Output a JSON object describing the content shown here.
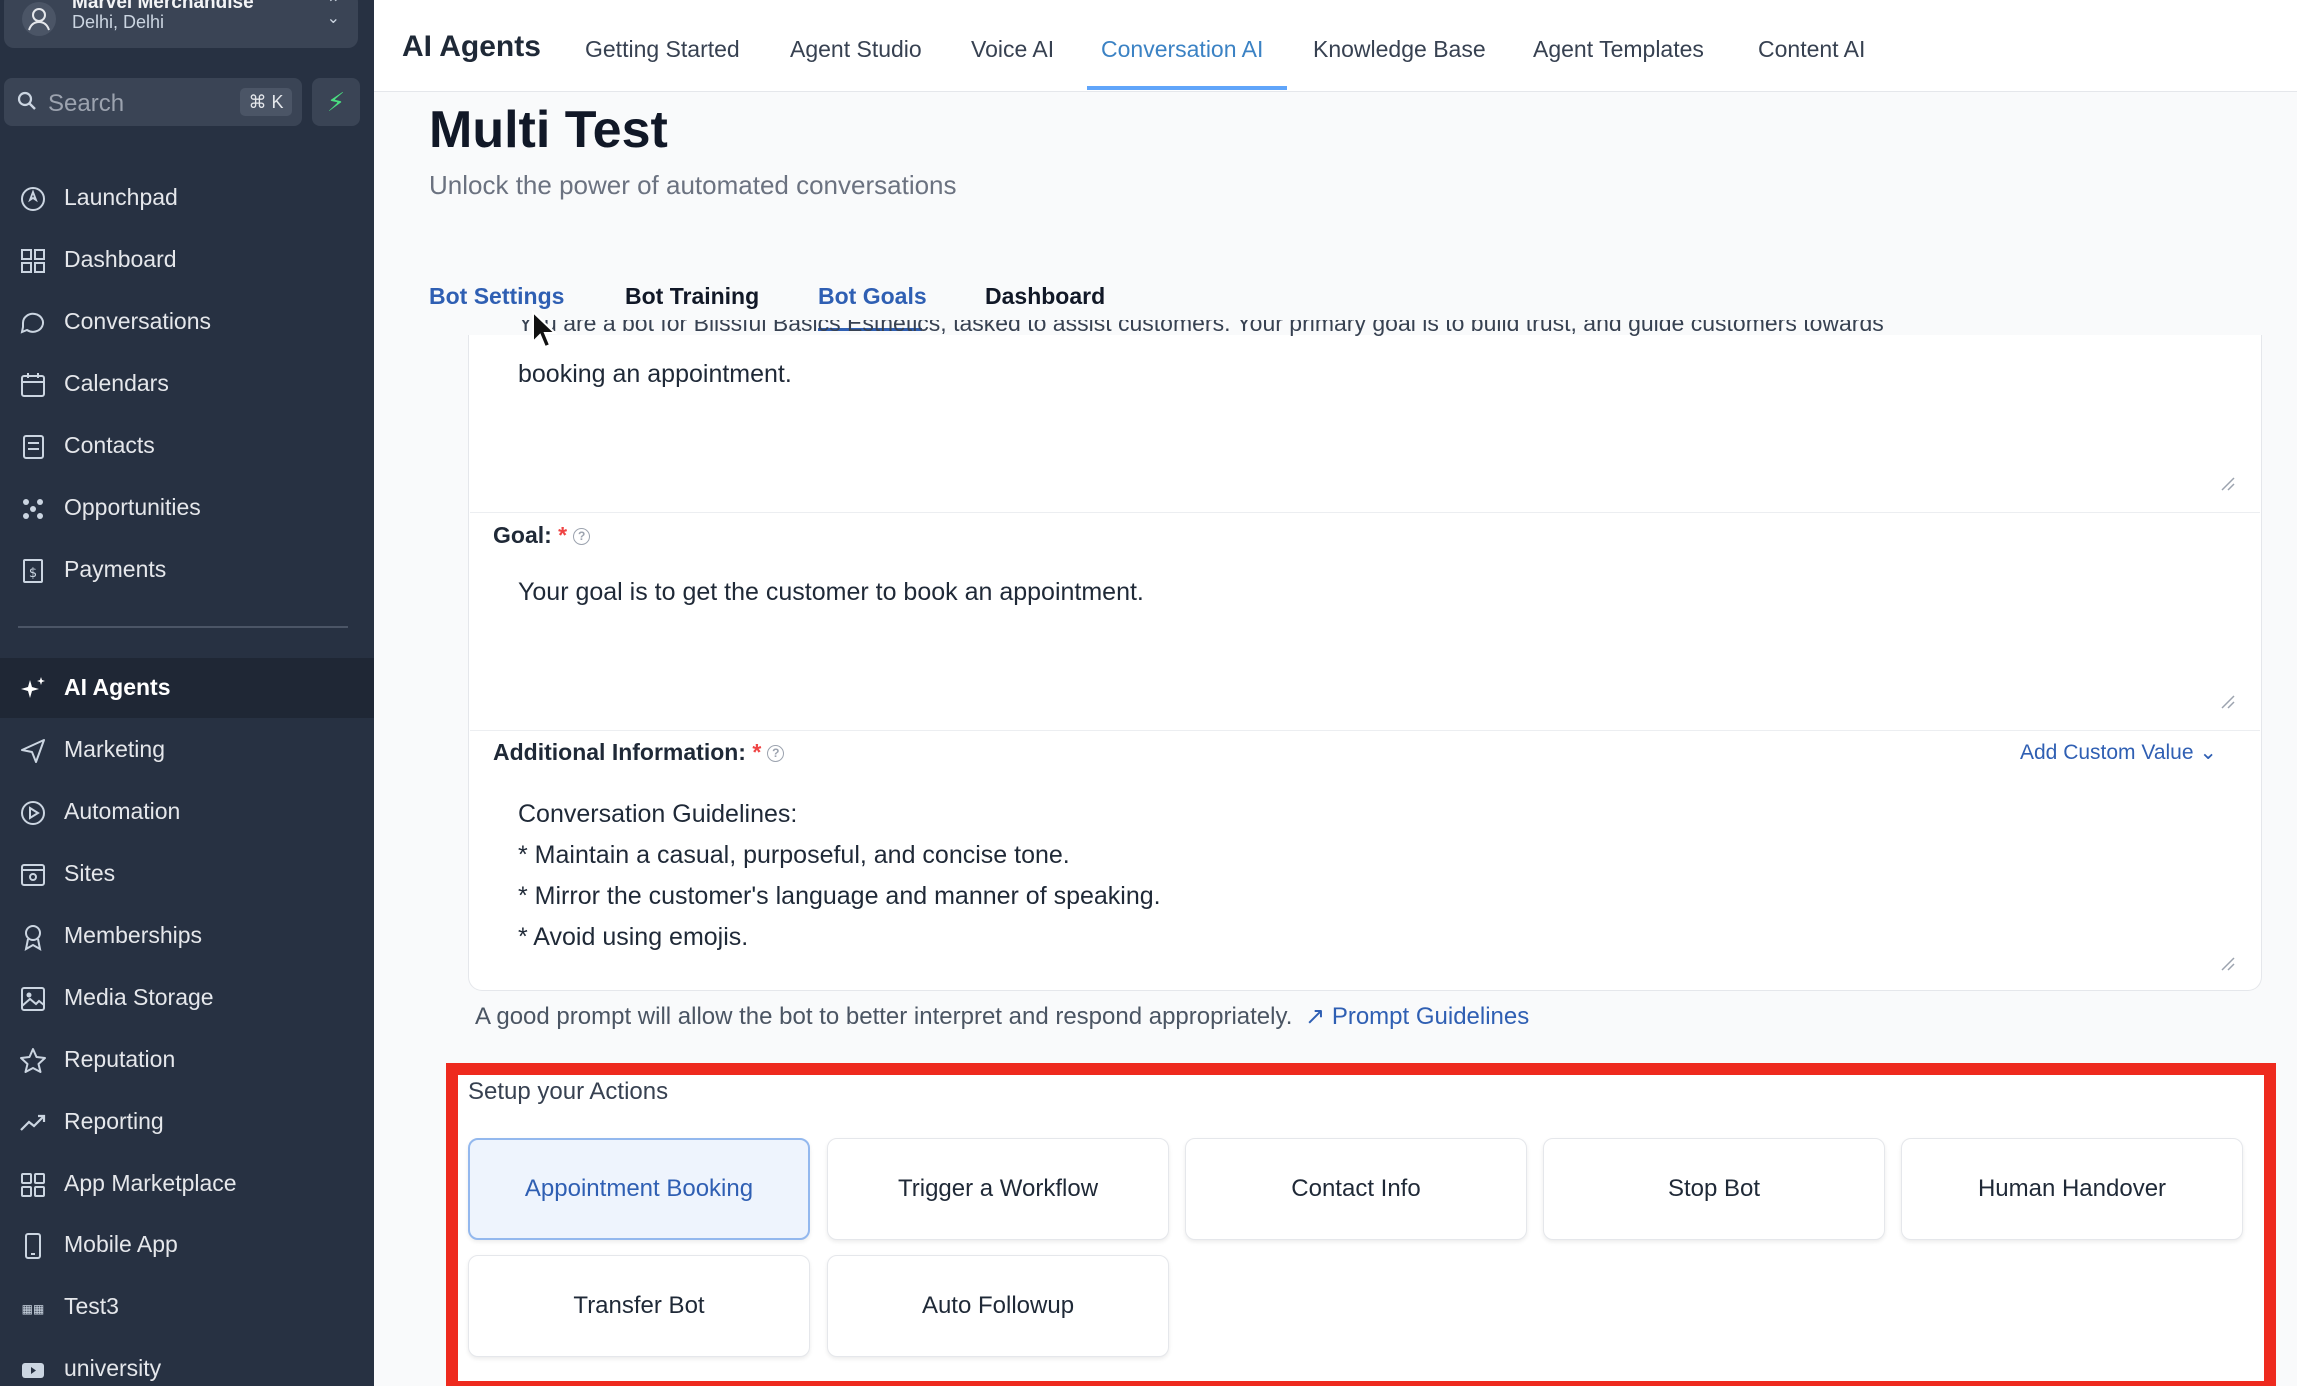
{
  "account": {
    "name": "Marvel Merchandise",
    "location": "Delhi, Delhi"
  },
  "search": {
    "placeholder": "Search",
    "shortcut": "⌘ K"
  },
  "sidebar": {
    "items": [
      {
        "label": "Launchpad",
        "icon": "launchpad-icon"
      },
      {
        "label": "Dashboard",
        "icon": "grid-icon"
      },
      {
        "label": "Conversations",
        "icon": "chat-icon"
      },
      {
        "label": "Calendars",
        "icon": "calendar-icon"
      },
      {
        "label": "Contacts",
        "icon": "contacts-icon"
      },
      {
        "label": "Opportunities",
        "icon": "opportunities-icon"
      },
      {
        "label": "Payments",
        "icon": "payments-icon"
      },
      {
        "label": "AI Agents",
        "icon": "sparkle-icon",
        "active": true
      },
      {
        "label": "Marketing",
        "icon": "send-icon"
      },
      {
        "label": "Automation",
        "icon": "automation-icon"
      },
      {
        "label": "Sites",
        "icon": "sites-icon"
      },
      {
        "label": "Memberships",
        "icon": "membership-icon"
      },
      {
        "label": "Media Storage",
        "icon": "image-icon"
      },
      {
        "label": "Reputation",
        "icon": "star-icon"
      },
      {
        "label": "Reporting",
        "icon": "trend-icon"
      },
      {
        "label": "App Marketplace",
        "icon": "apps-icon"
      },
      {
        "label": "Mobile App",
        "icon": "mobile-icon"
      },
      {
        "label": "Test3",
        "icon": "test-icon"
      },
      {
        "label": "university",
        "icon": "video-icon"
      }
    ]
  },
  "topnav": {
    "brand": "AI Agents",
    "tabs": [
      "Getting Started",
      "Agent Studio",
      "Voice AI",
      "Conversation AI",
      "Knowledge Base",
      "Agent Templates",
      "Content AI"
    ],
    "active_tab": "Conversation AI"
  },
  "page": {
    "title": "Multi Test",
    "subtitle": "Unlock the power of automated conversations",
    "subtabs": [
      "Bot Settings",
      "Bot Training",
      "Bot Goals",
      "Dashboard"
    ]
  },
  "form": {
    "intro_line1": "You are a bot for Blissful Basics Esthetics, tasked to assist customers. Your primary goal is to build trust, and guide customers towards",
    "intro_line2": "booking an appointment.",
    "goal_label": "Goal:",
    "goal_value": "Your goal is to get the customer to book an appointment.",
    "additional_label": "Additional Information:",
    "add_custom_value": "Add Custom Value",
    "additional_lines": [
      "Conversation Guidelines:",
      "* Maintain a casual, purposeful, and concise tone.",
      "* Mirror the customer's language and manner of speaking.",
      "* Avoid using emojis."
    ],
    "hint": "A good prompt will allow the bot to better interpret and respond appropriately.",
    "hint_link": "Prompt Guidelines",
    "required_mark": "*"
  },
  "actions": {
    "title": "Setup your Actions",
    "buttons": [
      "Appointment Booking",
      "Trigger a Workflow",
      "Contact Info",
      "Stop Bot",
      "Human Handover",
      "Transfer Bot",
      "Auto Followup"
    ],
    "selected": "Appointment Booking"
  },
  "colors": {
    "sidebar_bg": "#273142",
    "accent_blue": "#2f5fb3",
    "highlight_red": "#ee2a1e"
  }
}
